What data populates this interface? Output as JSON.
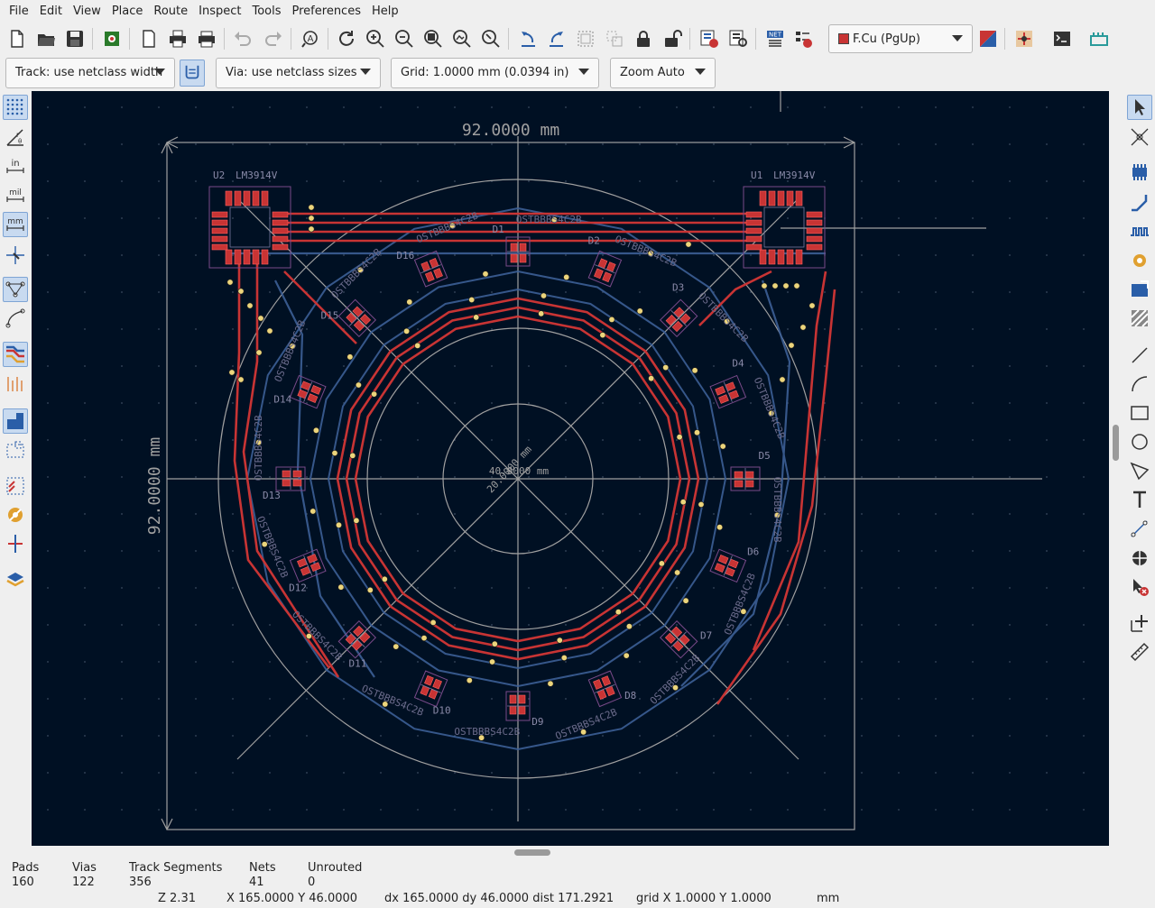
{
  "menu": [
    "File",
    "Edit",
    "View",
    "Place",
    "Route",
    "Inspect",
    "Tools",
    "Preferences",
    "Help"
  ],
  "toolbar": {
    "layer_label": "F.Cu (PgUp)",
    "layer_color": "#c83434"
  },
  "options": {
    "track": "Track: use netclass width",
    "via": "Via: use netclass sizes",
    "grid": "Grid: 1.0000 mm (0.0394 in)",
    "zoom": "Zoom Auto"
  },
  "left_tools": {
    "inch_label": "in",
    "mil_label": "mil",
    "mm_label": "mm"
  },
  "board": {
    "dim_horizontal": "92.0000 mm",
    "dim_vertical": "92.0000 mm",
    "dim_diameter": "40.0000 mm",
    "dim_radius": "20.0000 mm",
    "u1_ref": "U1",
    "u1_value": "LM3914V",
    "u2_ref": "U2",
    "u2_value": "LM3914V",
    "led_value": "OSTBBBS4C2B",
    "led_refs": [
      "D1",
      "D2",
      "D3",
      "D4",
      "D5",
      "D6",
      "D7",
      "D8",
      "D9",
      "D10",
      "D11",
      "D12",
      "D13",
      "D14",
      "D15",
      "D16"
    ]
  },
  "status": {
    "pads_label": "Pads",
    "pads": "160",
    "vias_label": "Vias",
    "vias": "122",
    "tracks_label": "Track Segments",
    "tracks": "356",
    "nets_label": "Nets",
    "nets": "41",
    "unrouted_label": "Unrouted",
    "unrouted": "0",
    "zoom": "Z 2.31",
    "xy": "X 165.0000  Y 46.0000",
    "delta": "dx 165.0000  dy 46.0000  dist 171.2921",
    "grid": "grid X 1.0000  Y 1.0000",
    "units": "mm"
  },
  "colors": {
    "board_bg": "#001023",
    "fcu": "#c83434",
    "bcu": "#4d7fc4",
    "via": "#ecd57c",
    "edge": "#a0a0a0",
    "fab": "#7a7a9a"
  }
}
